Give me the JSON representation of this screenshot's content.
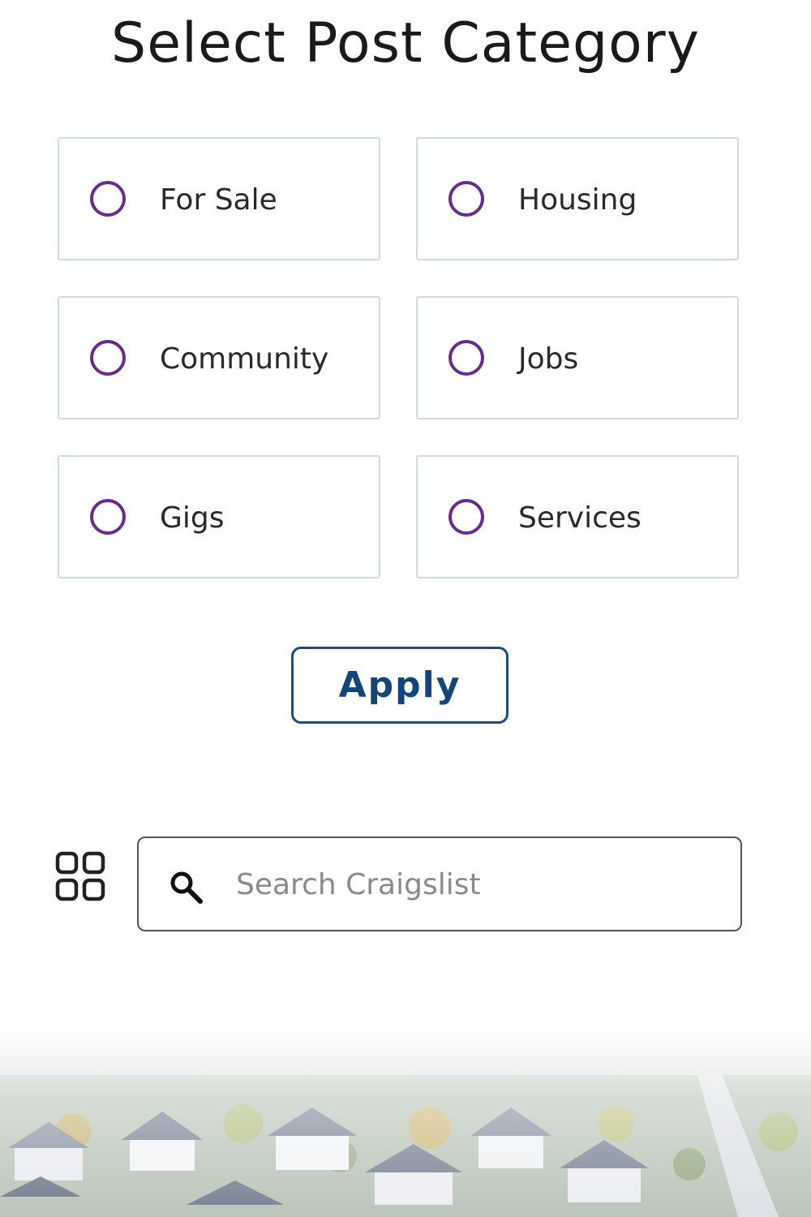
{
  "page": {
    "title": "Select Post Category"
  },
  "categories": [
    {
      "label": "For Sale",
      "selected": false
    },
    {
      "label": "Housing",
      "selected": false
    },
    {
      "label": "Community",
      "selected": false
    },
    {
      "label": "Jobs",
      "selected": false
    },
    {
      "label": "Gigs",
      "selected": false
    },
    {
      "label": "Services",
      "selected": false
    }
  ],
  "apply_button": {
    "label": "Apply"
  },
  "search": {
    "placeholder": "Search Craigslist",
    "value": ""
  },
  "icons": {
    "radio": "radio-unchecked-icon",
    "grid": "grid-menu-icon",
    "search": "search-icon"
  },
  "colors": {
    "radio_border": "#6a2a8f",
    "card_border": "#cddbe8",
    "apply_text": "#124679",
    "apply_border": "#1b4c86",
    "title_text": "#1a1a1a"
  }
}
